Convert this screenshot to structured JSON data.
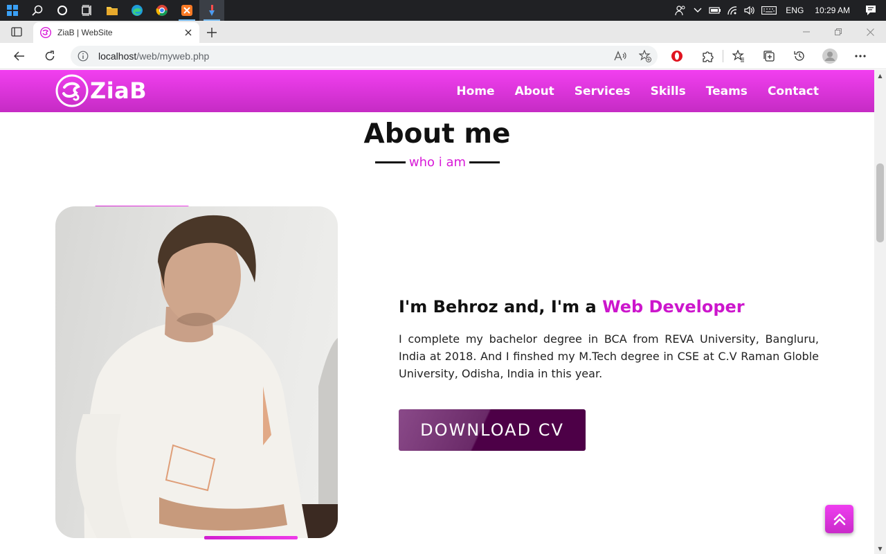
{
  "taskbar": {
    "icons": [
      "windows-start-icon",
      "search-icon",
      "cortana-icon",
      "task-view-icon",
      "file-explorer-icon",
      "edge-icon",
      "chrome-icon",
      "xampp-icon",
      "app-icon"
    ],
    "language": "ENG",
    "clock": "10:29 AM"
  },
  "browser": {
    "tab_title": "ZiaB | WebSite",
    "url_host": "localhost",
    "url_path": "/web/myweb.php"
  },
  "site": {
    "logo_text": "ZiaB",
    "nav": [
      "Home",
      "About",
      "Services",
      "Skills",
      "Teams",
      "Contact"
    ],
    "section_title": "About me",
    "section_subtitle": "who i am",
    "intro_prefix": "I'm Behroz and, I'm a ",
    "intro_highlight": "Web Developer",
    "description": "I complete my bachelor degree in BCA from REVA University, Bangluru, India at 2018. And I finshed my M.Tech degree in CSE at C.V Raman Globle University, Odisha, India in this year.",
    "cv_button": "DOWNLOAD CV"
  },
  "colors": {
    "brand_magenta": "#e23be0",
    "highlight": "#cc16cc",
    "button_dark": "#4d0047"
  }
}
